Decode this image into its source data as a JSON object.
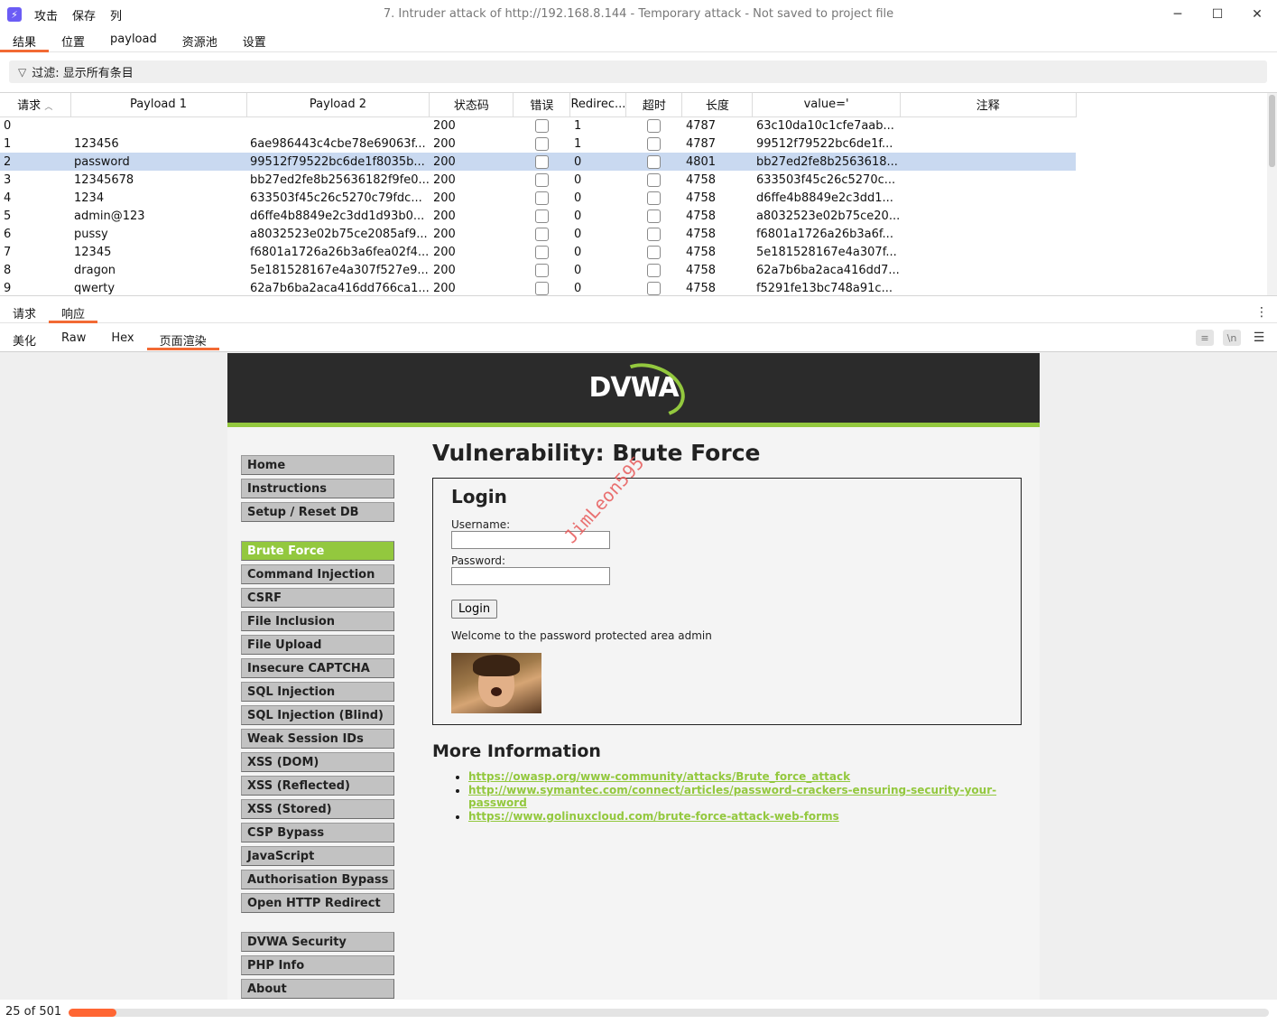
{
  "app": {
    "menu": [
      "攻击",
      "保存",
      "列"
    ],
    "title": "7. Intruder attack of http://192.168.8.144 - Temporary attack - Not saved to project file",
    "window_controls": [
      "─",
      "☐",
      "✕"
    ]
  },
  "top_tabs": [
    "结果",
    "位置",
    "payload",
    "资源池",
    "设置"
  ],
  "filter": {
    "text": "过滤: 显示所有条目"
  },
  "table": {
    "columns": [
      "请求",
      "Payload 1",
      "Payload 2",
      "状态码",
      "错误",
      "Redirec...",
      "超时",
      "长度",
      "value='",
      "注释"
    ],
    "rows": [
      [
        "0",
        "",
        "",
        "200",
        "1",
        "4787",
        "63c10da10c1cfe7aab..."
      ],
      [
        "1",
        "123456",
        "6ae986443c4cbe78e69063f...",
        "200",
        "1",
        "4787",
        "99512f79522bc6de1f..."
      ],
      [
        "2",
        "password",
        "99512f79522bc6de1f8035b...",
        "200",
        "0",
        "4801",
        "bb27ed2fe8b2563618..."
      ],
      [
        "3",
        "12345678",
        "bb27ed2fe8b25636182f9fe0...",
        "200",
        "0",
        "4758",
        "633503f45c26c5270c..."
      ],
      [
        "4",
        "1234",
        "633503f45c26c5270c79fdc...",
        "200",
        "0",
        "4758",
        "d6ffe4b8849e2c3dd1..."
      ],
      [
        "5",
        "admin@123",
        "d6ffe4b8849e2c3dd1d93b0...",
        "200",
        "0",
        "4758",
        "a8032523e02b75ce20..."
      ],
      [
        "6",
        "pussy",
        "a8032523e02b75ce2085af9...",
        "200",
        "0",
        "4758",
        "f6801a1726a26b3a6f..."
      ],
      [
        "7",
        "12345",
        "f6801a1726a26b3a6fea02f4...",
        "200",
        "0",
        "4758",
        "5e181528167e4a307f..."
      ],
      [
        "8",
        "dragon",
        "5e181528167e4a307f527e9...",
        "200",
        "0",
        "4758",
        "62a7b6ba2aca416dd7..."
      ],
      [
        "9",
        "qwerty",
        "62a7b6ba2aca416dd766ca1...",
        "200",
        "0",
        "4758",
        "f5291fe13bc748a91c..."
      ]
    ],
    "selected_row": 2
  },
  "req_tabs": [
    "请求",
    "响应"
  ],
  "view_tabs": [
    "美化",
    "Raw",
    "Hex",
    "页面渲染"
  ],
  "dvwa": {
    "logo": "DVWA",
    "nav_group1": [
      "Home",
      "Instructions",
      "Setup / Reset DB"
    ],
    "nav_group2": [
      "Brute Force",
      "Command Injection",
      "CSRF",
      "File Inclusion",
      "File Upload",
      "Insecure CAPTCHA",
      "SQL Injection",
      "SQL Injection (Blind)",
      "Weak Session IDs",
      "XSS (DOM)",
      "XSS (Reflected)",
      "XSS (Stored)",
      "CSP Bypass",
      "JavaScript",
      "Authorisation Bypass",
      "Open HTTP Redirect"
    ],
    "nav_group3": [
      "DVWA Security",
      "PHP Info",
      "About"
    ],
    "heading": "Vulnerability: Brute Force",
    "login_title": "Login",
    "username_label": "Username:",
    "password_label": "Password:",
    "login_button": "Login",
    "welcome": "Welcome to the password protected area admin",
    "more_info": "More Information",
    "links": [
      "https://owasp.org/www-community/attacks/Brute_force_attack",
      "http://www.symantec.com/connect/articles/password-crackers-ensuring-security-your-password",
      "https://www.golinuxcloud.com/brute-force-attack-web-forms"
    ],
    "watermark": "JimLeon595"
  },
  "status": {
    "count": "25 of 501",
    "progress": 0.04
  },
  "colors": {
    "accent": "#f26a34",
    "dvwa_green": "#93c83e",
    "selected_row": "#c9d9f0",
    "progress": "#ff6633"
  }
}
